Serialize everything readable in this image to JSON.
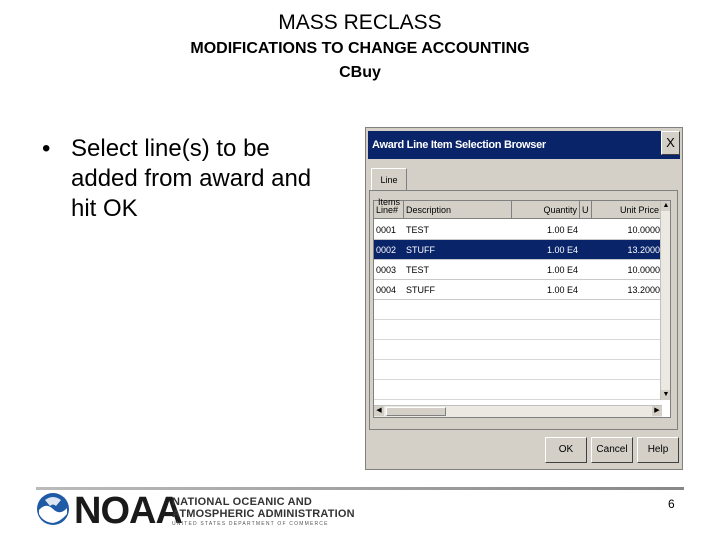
{
  "slide": {
    "title": "MASS RECLASS",
    "subtitle": "MODIFICATIONS TO CHANGE ACCOUNTING",
    "subtitle2": "CBuy",
    "bullet": "Select line(s) to be added from award and hit OK",
    "page_number": "6"
  },
  "dialog": {
    "title": "Award Line Item Selection Browser",
    "close_label": "X",
    "tab_label": "Line Items",
    "columns": [
      "Line#",
      "Description",
      "Quantity",
      "U",
      "Unit Price"
    ],
    "rows": [
      {
        "line": "0001",
        "description": "TEST",
        "quantity": "1.00 E4",
        "unit": "",
        "unit_price": "10.0000",
        "selected": false
      },
      {
        "line": "0002",
        "description": "STUFF",
        "quantity": "1.00 E4",
        "unit": "",
        "unit_price": "13.2000",
        "selected": true
      },
      {
        "line": "0003",
        "description": "TEST",
        "quantity": "1.00 E4",
        "unit": "",
        "unit_price": "10.0000",
        "selected": false
      },
      {
        "line": "0004",
        "description": "STUFF",
        "quantity": "1.00 E4",
        "unit": "",
        "unit_price": "13.2000",
        "selected": false
      }
    ],
    "buttons": {
      "ok": "OK",
      "cancel": "Cancel",
      "help": "Help"
    }
  },
  "footer": {
    "logo_text": "NOAA",
    "org_line1": "NATIONAL OCEANIC AND",
    "org_line2": "ATMOSPHERIC ADMINISTRATION",
    "org_line3": "UNITED STATES DEPARTMENT OF COMMERCE"
  },
  "colors": {
    "selection": "#0a246a",
    "dialog_bg": "#d4d0c8",
    "noaa_blue": "#1f5aa6"
  }
}
